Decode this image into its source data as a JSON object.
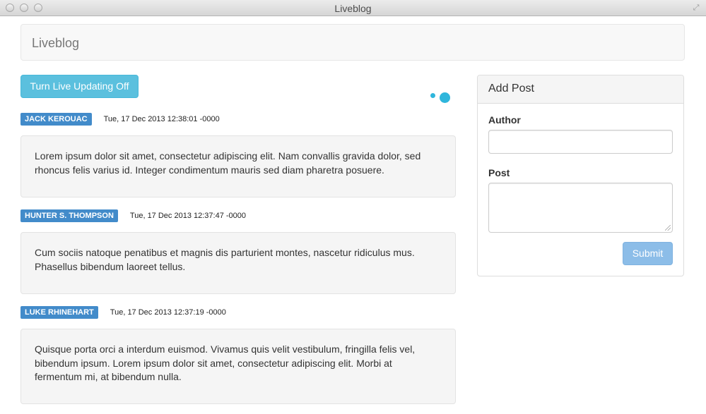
{
  "window": {
    "title": "Liveblog"
  },
  "navbar": {
    "brand": "Liveblog"
  },
  "controls": {
    "toggle_label": "Turn Live Updating Off"
  },
  "posts": [
    {
      "author": "JACK KEROUAC",
      "timestamp": "Tue, 17 Dec 2013 12:38:01 -0000",
      "body": "Lorem ipsum dolor sit amet, consectetur adipiscing elit. Nam convallis gravida dolor, sed rhoncus felis varius id. Integer condimentum mauris sed diam pharetra posuere."
    },
    {
      "author": "HUNTER S. THOMPSON",
      "timestamp": "Tue, 17 Dec 2013 12:37:47 -0000",
      "body": "Cum sociis natoque penatibus et magnis dis parturient montes, nascetur ridiculus mus. Phasellus bibendum laoreet tellus."
    },
    {
      "author": "LUKE RHINEHART",
      "timestamp": "Tue, 17 Dec 2013 12:37:19 -0000",
      "body": "Quisque porta orci a interdum euismod. Vivamus quis velit vestibulum, fringilla felis vel, bibendum ipsum. Lorem ipsum dolor sit amet, consectetur adipiscing elit. Morbi at fermentum mi, at bibendum nulla."
    }
  ],
  "add_post": {
    "heading": "Add Post",
    "author_label": "Author",
    "author_value": "",
    "post_label": "Post",
    "post_value": "",
    "submit_label": "Submit"
  },
  "colors": {
    "info": "#5bc0de",
    "label_primary": "#428bca",
    "submit_disabled": "#8cbde8",
    "spinner": "#2fb6dc"
  },
  "icons": {
    "loading": "loading-dots-icon",
    "resize": "fullscreen-icon"
  }
}
